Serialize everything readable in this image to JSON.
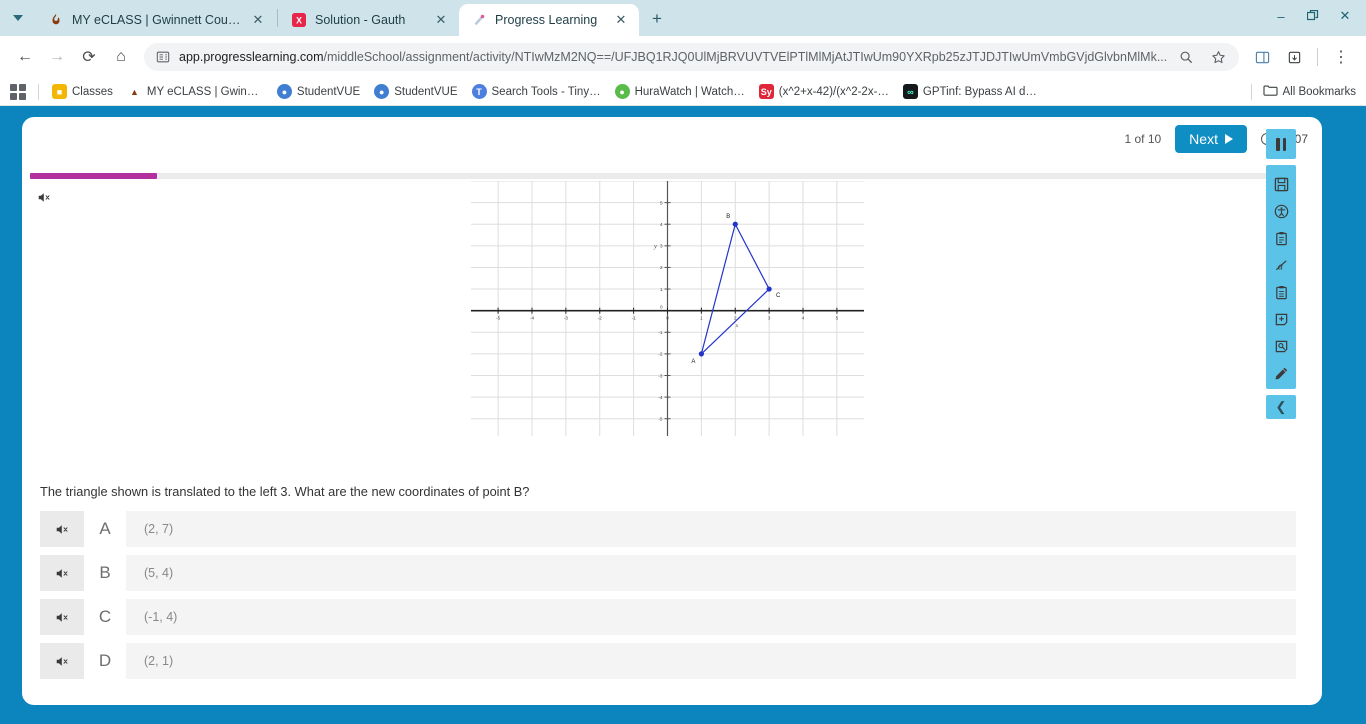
{
  "browser": {
    "tabs": [
      {
        "title": "MY eCLASS | Gwinnett County P",
        "favicon": "flame-icon",
        "active": false
      },
      {
        "title": "Solution - Gauth",
        "favicon": "gauth-icon",
        "active": false
      },
      {
        "title": "Progress Learning",
        "favicon": "progress-learning-icon",
        "active": true
      }
    ],
    "newtab_label": "+",
    "window_controls": {
      "minimize": "–",
      "maximize": "❐",
      "close": "✕"
    },
    "nav": {
      "back": "←",
      "forward": "→",
      "reload": "⟳",
      "home": "⌂"
    },
    "omnibox": {
      "host": "app.progresslearning.com",
      "path": "/middleSchool/assignment/activity/NTIwMzM2NQ==/UFJBQ1RJQ0UlMjBRVUVTVElPTlMlMjAtJTIwUm90YXRpb25zJTJDJTIwUmVmbGVjdGlvbnMlMk...",
      "site_icon": "page-info-icon",
      "zoom_icon": "search-icon",
      "bookmark_icon": "star-icon",
      "split_icon": "split-screen-icon",
      "extensions_icon": "extensions-icon",
      "menu_icon": "kebab-menu-icon"
    },
    "bookmarks": [
      {
        "label": "Classes",
        "icon": "classes-icon",
        "color": "#f2b705"
      },
      {
        "label": "MY eCLASS | Gwinn…",
        "icon": "flame-icon",
        "color": "#8a3b12"
      },
      {
        "label": "StudentVUE",
        "icon": "studentvue-icon",
        "color": "#3f7ed1"
      },
      {
        "label": "StudentVUE",
        "icon": "studentvue-icon",
        "color": "#3f7ed1"
      },
      {
        "label": "Search Tools - Tiny…",
        "icon": "tinywow-icon",
        "color": "#4e7fdf"
      },
      {
        "label": "HuraWatch | Watch…",
        "icon": "hurawatch-icon",
        "color": "#5bbb4a"
      },
      {
        "label": "(x^2+x-42)/(x^2-2x-…",
        "icon": "symbolab-icon",
        "color": "#e0273a"
      },
      {
        "label": "GPTinf: Bypass AI d…",
        "icon": "gptinf-icon",
        "color": "#16191c"
      }
    ],
    "all_bookmarks_label": "All Bookmarks",
    "all_bookmarks_icon": "folder-icon",
    "apps_icon": "apps-grid-icon"
  },
  "activity": {
    "question_counter": "1 of 10",
    "next_label": "Next",
    "timer": "00:07",
    "progress_percent": 10,
    "progress_color": "#b32f9e",
    "accent_color": "#0f8ec4",
    "question_text": "The triangle shown is translated to the left 3. What are the new coordinates of point B?",
    "question_speaker_icon": "speaker-muted-icon",
    "options": [
      {
        "letter": "A",
        "text": "(2, 7)",
        "speaker_icon": "speaker-muted-icon"
      },
      {
        "letter": "B",
        "text": "(5, 4)",
        "speaker_icon": "speaker-muted-icon"
      },
      {
        "letter": "C",
        "text": "(-1, 4)",
        "speaker_icon": "speaker-muted-icon"
      },
      {
        "letter": "D",
        "text": "(2, 1)",
        "speaker_icon": "speaker-muted-icon"
      }
    ],
    "rail": {
      "pause_icon": "pause-icon",
      "tools": [
        "save-icon",
        "accessibility-icon",
        "clipboard-icon",
        "strikethrough-icon",
        "notes-icon",
        "add-note-icon",
        "highlight-icon",
        "pencil-icon"
      ],
      "collapse_icon": "chevron-left-icon"
    }
  },
  "chart_data": {
    "type": "scatter",
    "title": "",
    "xlabel": "x",
    "ylabel": "y",
    "xlim": [
      -5.8,
      5.8
    ],
    "ylim": [
      -5.8,
      6.0
    ],
    "xticks": [
      -5,
      -4,
      -3,
      -2,
      -1,
      0,
      1,
      2,
      3,
      4,
      5
    ],
    "yticks": [
      -5,
      -4,
      -3,
      -2,
      -1,
      0,
      1,
      2,
      3,
      4,
      5
    ],
    "grid": true,
    "grid_color": "#dddddd",
    "axis_color": "#222222",
    "series_color": "#2233cc",
    "points": [
      {
        "label": "A",
        "x": 1,
        "y": -2
      },
      {
        "label": "B",
        "x": 2,
        "y": 4
      },
      {
        "label": "C",
        "x": 3,
        "y": 1
      }
    ],
    "edges": [
      [
        "A",
        "B"
      ],
      [
        "B",
        "C"
      ],
      [
        "C",
        "A"
      ]
    ],
    "annotation": "Triangle ABC plotted on the coordinate plane"
  }
}
